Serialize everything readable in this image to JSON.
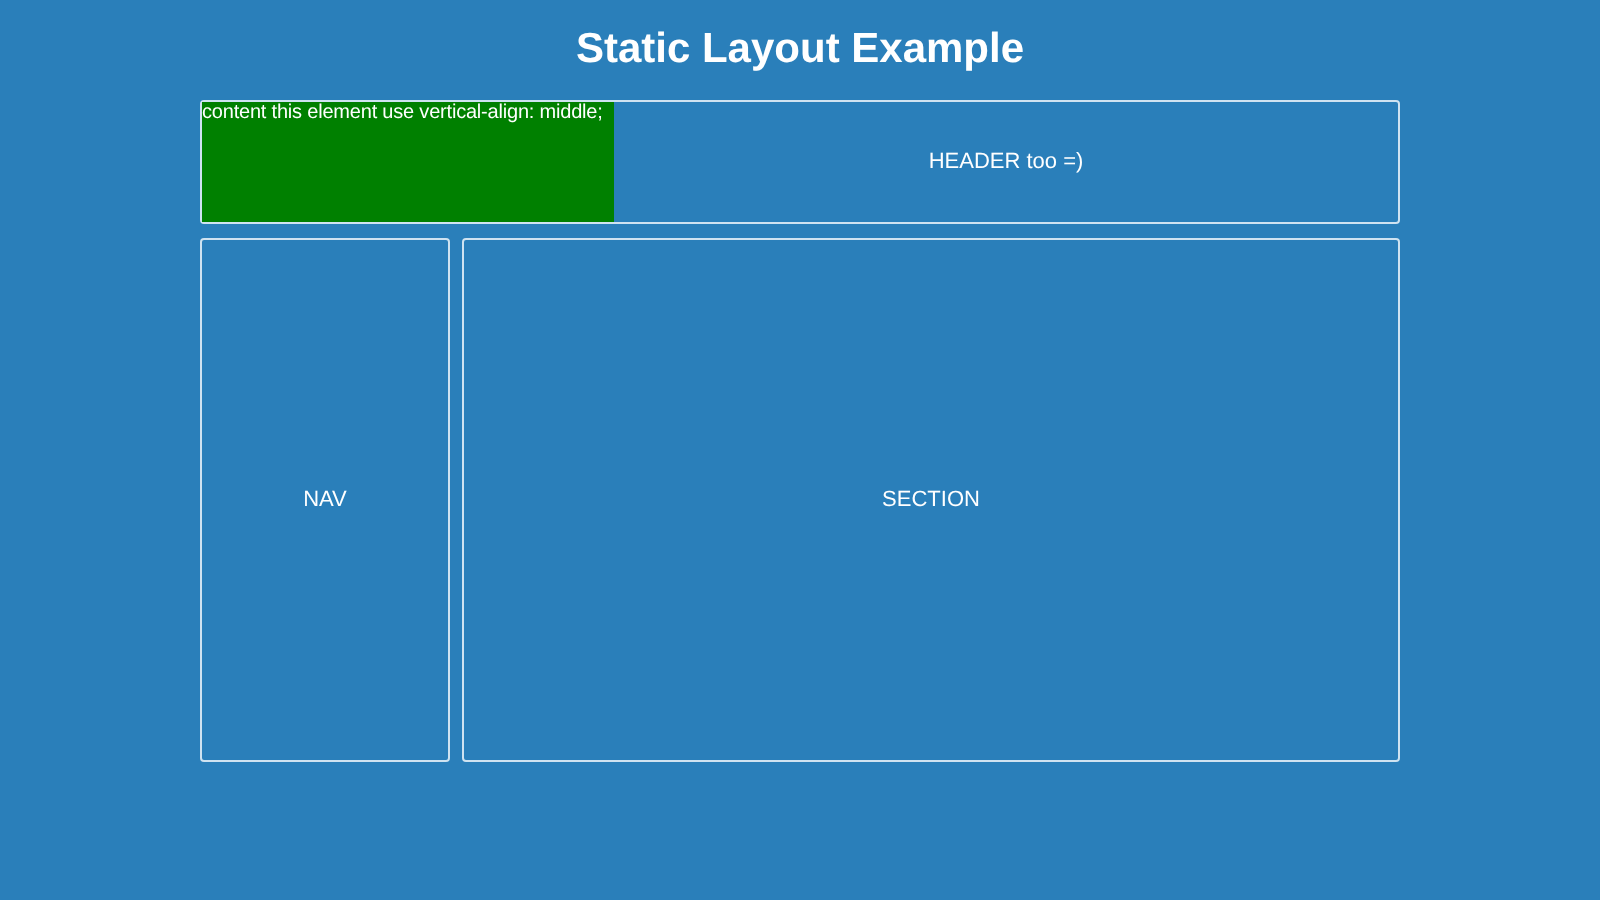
{
  "title": "Static Layout Example",
  "header": {
    "note": "content this element use vertical-align: middle;",
    "label": "HEADER too =)"
  },
  "nav": {
    "label": "NAV"
  },
  "section": {
    "label": "SECTION"
  }
}
